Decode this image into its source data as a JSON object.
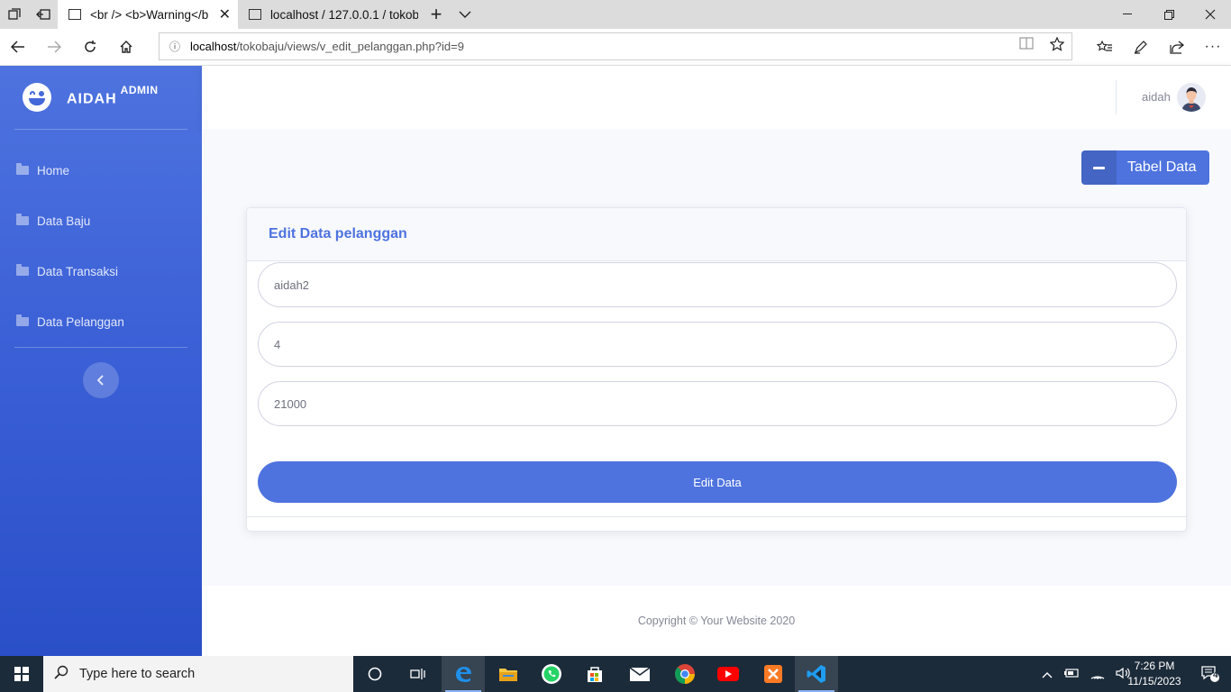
{
  "browser": {
    "tabs": [
      {
        "title": "<br /> <b>Warning</b",
        "active": true
      },
      {
        "title": "localhost / 127.0.0.1 / tokob",
        "active": false
      }
    ],
    "url_host": "localhost",
    "url_path": "/tokobaju/views/v_edit_pelanggan.php?id=9"
  },
  "sidebar": {
    "brand": "AIDAH",
    "brand_sup": "ADMIN",
    "items": [
      {
        "label": "Home"
      },
      {
        "label": "Data Baju"
      },
      {
        "label": "Data Transaksi"
      },
      {
        "label": "Data Pelanggan"
      }
    ]
  },
  "topbar": {
    "user": "aidah"
  },
  "main": {
    "tabel_button": "Tabel Data",
    "card_title": "Edit Data pelanggan",
    "fields": [
      {
        "value": "aidah2"
      },
      {
        "value": "4"
      },
      {
        "value": "21000"
      }
    ],
    "submit": "Edit Data"
  },
  "footer": {
    "text": "Copyright © Your Website 2020"
  },
  "taskbar": {
    "search_placeholder": "Type here to search",
    "time": "7:26 PM",
    "date": "11/15/2023",
    "notifications": "4"
  },
  "colors": {
    "primary": "#4e73df",
    "sidebar_bottom": "#2a4fc8",
    "content_bg": "#f8f9fc",
    "taskbar": "#1c2b3a"
  }
}
